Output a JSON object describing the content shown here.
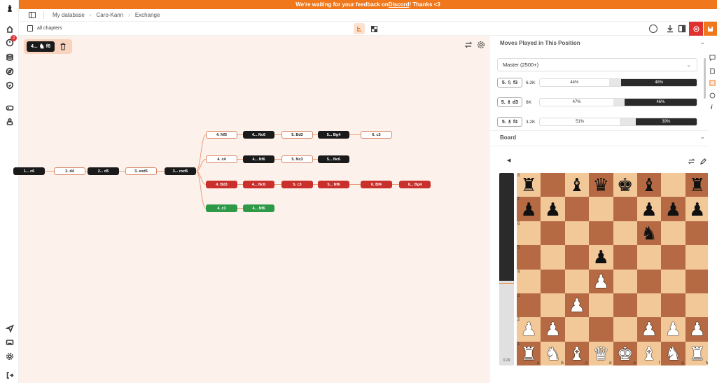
{
  "banner": {
    "text_pre": "We're waiting for your feedback on ",
    "link": "Discord",
    "text_post": " ! Thanks <3"
  },
  "breadcrumb": {
    "items": [
      "My database",
      "Caro-Kann",
      "Exchange"
    ]
  },
  "toolbar": {
    "chapters_label": "all chapters"
  },
  "notification_badge": "2",
  "selected_move": {
    "prefix": "4...",
    "piece": "♞",
    "square": "f6"
  },
  "graph": {
    "nodes": [
      {
        "label": "1... c6",
        "style": "black"
      },
      {
        "label": "2. d4",
        "style": "white"
      },
      {
        "label": "2... d5",
        "style": "black"
      },
      {
        "label": "3. exd5",
        "style": "white"
      },
      {
        "label": "3... cxd5",
        "style": "black"
      },
      {
        "label": "4. Nf3",
        "style": "white"
      },
      {
        "label": "4... Nc6",
        "style": "black"
      },
      {
        "label": "5. Bd3",
        "style": "white"
      },
      {
        "label": "5... Bg4",
        "style": "black"
      },
      {
        "label": "6. c3",
        "style": "white"
      },
      {
        "label": "4. c4",
        "style": "white"
      },
      {
        "label": "4... Nf6",
        "style": "black"
      },
      {
        "label": "5. Nc3",
        "style": "white"
      },
      {
        "label": "5... Nc6",
        "style": "black"
      },
      {
        "label": "4. Bd3",
        "style": "red"
      },
      {
        "label": "4... Nc6",
        "style": "red"
      },
      {
        "label": "5. c3",
        "style": "red"
      },
      {
        "label": "5... Nf6",
        "style": "red"
      },
      {
        "label": "6. Bf4",
        "style": "red"
      },
      {
        "label": "6... Bg4",
        "style": "red"
      },
      {
        "label": "4. c3",
        "style": "green"
      },
      {
        "label": "4... Nf6",
        "style": "green"
      }
    ],
    "edges": [
      [
        0,
        1
      ],
      [
        1,
        2
      ],
      [
        2,
        3
      ],
      [
        3,
        4
      ],
      [
        4,
        5
      ],
      [
        5,
        6
      ],
      [
        6,
        7
      ],
      [
        7,
        8
      ],
      [
        8,
        9
      ],
      [
        4,
        10
      ],
      [
        10,
        11
      ],
      [
        11,
        12
      ],
      [
        12,
        13
      ],
      [
        4,
        14
      ],
      [
        14,
        15
      ],
      [
        15,
        16
      ],
      [
        16,
        17
      ],
      [
        17,
        18
      ],
      [
        18,
        19
      ],
      [
        4,
        20
      ],
      [
        20,
        21
      ]
    ]
  },
  "moves_panel": {
    "title": "Moves Played in This Position",
    "filter": "Master (2500+)",
    "moves": [
      {
        "label": "5. ♘ f3",
        "count": "6.2K",
        "white": 44,
        "draw": 8,
        "black": 48,
        "white_label": "44%",
        "black_label": "48%"
      },
      {
        "label": "5. ♗ d3",
        "count": "6K",
        "white": 47,
        "draw": 7,
        "black": 46,
        "white_label": "47%",
        "black_label": "46%"
      },
      {
        "label": "5. ♗ f4",
        "count": "3.2K",
        "white": 51,
        "draw": 10,
        "black": 39,
        "white_label": "51%",
        "black_label": "39%"
      }
    ]
  },
  "board_panel": {
    "title": "Board",
    "eval_label": "0.29",
    "eval_white_fraction": 0.44,
    "position": [
      "r.bqkb.r",
      "pp...ppp",
      ".....n..",
      "...p....",
      "...P....",
      "..P.....",
      "PP...PPP",
      "RNBQKBNR"
    ],
    "ranks": [
      "8",
      "7",
      "6",
      "5",
      "4",
      "3",
      "2",
      "1"
    ],
    "files": [
      "a",
      "b",
      "c",
      "d",
      "e",
      "f",
      "g",
      "h"
    ]
  },
  "colors": {
    "accent": "#f0771b",
    "red": "#c9302c",
    "green": "#2e9a48",
    "board_light": "#f3c898",
    "board_dark": "#b56a43"
  }
}
